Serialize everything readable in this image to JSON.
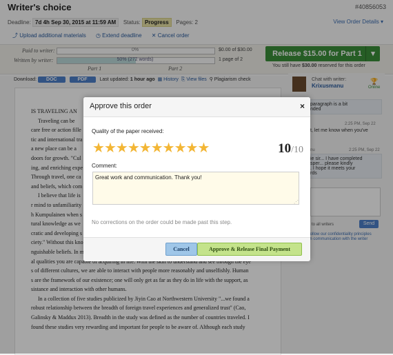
{
  "header": {
    "title": "Writer's choice",
    "order_id": "#40856053",
    "deadline_label": "Deadline:",
    "deadline_value": "7d 4h Sep 30, 2015 at 11:59 AM",
    "status_label": "Status:",
    "status_value": "Progress",
    "pages_label": "Pages:",
    "pages_value": "2",
    "view_details": "View Order Details ▾",
    "actions": [
      "Upload additional materials",
      "Extend deadline",
      "Cancel order"
    ]
  },
  "payment": {
    "paid_label": "Paid to writer:",
    "paid_track": "0%",
    "paid_amount": "$0.00 of $30.00",
    "written_label": "Written by writer:",
    "written_track": "50%  (272 words)",
    "written_fraction": 0.5,
    "written_pages": "1 page of 2",
    "part1": "Part 1",
    "part2": "Part 2",
    "release_button": "Release $15.00 for Part 1",
    "reserved_prefix": "You still have",
    "reserved_amount": "$30.00",
    "reserved_suffix": "reserved for this order"
  },
  "toolbar": {
    "download_label": "Download:",
    "doc_button": "DOC",
    "pdf_button": "PDF",
    "last_updated": "Last updated:",
    "last_updated_value": "1 hour ago",
    "history": "History",
    "view_files": "View files",
    "plagiarism": "Plagiarism check"
  },
  "paper": {
    "lines": [
      "IS TRAVELING AN",
      "Traveling can be",
      "care free or action fille",
      "tic and international tra",
      "a new place can be a",
      "doors for growth. \"Cul",
      "ing, and enriching expe",
      "Through travel, one ca",
      "and beliefs, which com",
      "I believe that life is",
      "r mind to unfamiliarity",
      "h Kumpulainen when s",
      "tural knowledge as we",
      "cratic and developing s",
      "ciety.\" Without this kno",
      "nguishable beliefs. In my opinion, broadening your mind can be one of the most personally benefici",
      "al qualities you are capable of acquiring in life. With the skill to understand and see through the eye",
      "s of different cultures, we are able to interact with people more reasonably and unselfishly. Human",
      "s are the framework of our existence; one will only get as far as they do in life with the support, as",
      "sistance and interaction with other humans.",
      "In a collection of five studies publicized by Jiyin Cao at Northwestern University \"...we found a",
      "robust relationship between the breadth of foreign travel experiences and generalized trust\" (Cao,",
      "Galinsky & Maddux 2013). Breadth in the study was defined as the number of countries traveled. I",
      " found these studies very rewarding and important for people to be aware of. Although each study"
    ]
  },
  "chat": {
    "header": "Chat with writer:",
    "writer_name": "Krixusmanu",
    "writer_status": "Online",
    "msg1": "paragraph is a bit\nnded",
    "msg1_time": "2:25 PM, Sep 22",
    "msg2": "t, let me know when you've",
    "msg3_sender": "nu",
    "msg3_time": "2:25 PM, Sep 22",
    "msg3": "ie sir... I have completed\nsper... please kindly\n. I hope it meets your\nrds",
    "to_all": "to all writers",
    "send": "Send",
    "policy": "follow our confidentiality principles\nin communication with the writer"
  },
  "modal": {
    "title": "Approve this order",
    "close": "×",
    "quality_label": "Quality of the paper received:",
    "rating": 10,
    "rating_max": 10,
    "score_big": "10",
    "score_small": "/10",
    "comment_label": "Comment:",
    "comment_value": "Great work and communication. Thank you!",
    "note": "No corrections on the order could be made past this step.",
    "cancel_button": "Cancel",
    "approve_button": "Approve & Release Final Payment"
  },
  "colors": {
    "release_green": "#3b8f39",
    "star_gold": "#f3b635",
    "link_blue": "#3b6db2"
  }
}
